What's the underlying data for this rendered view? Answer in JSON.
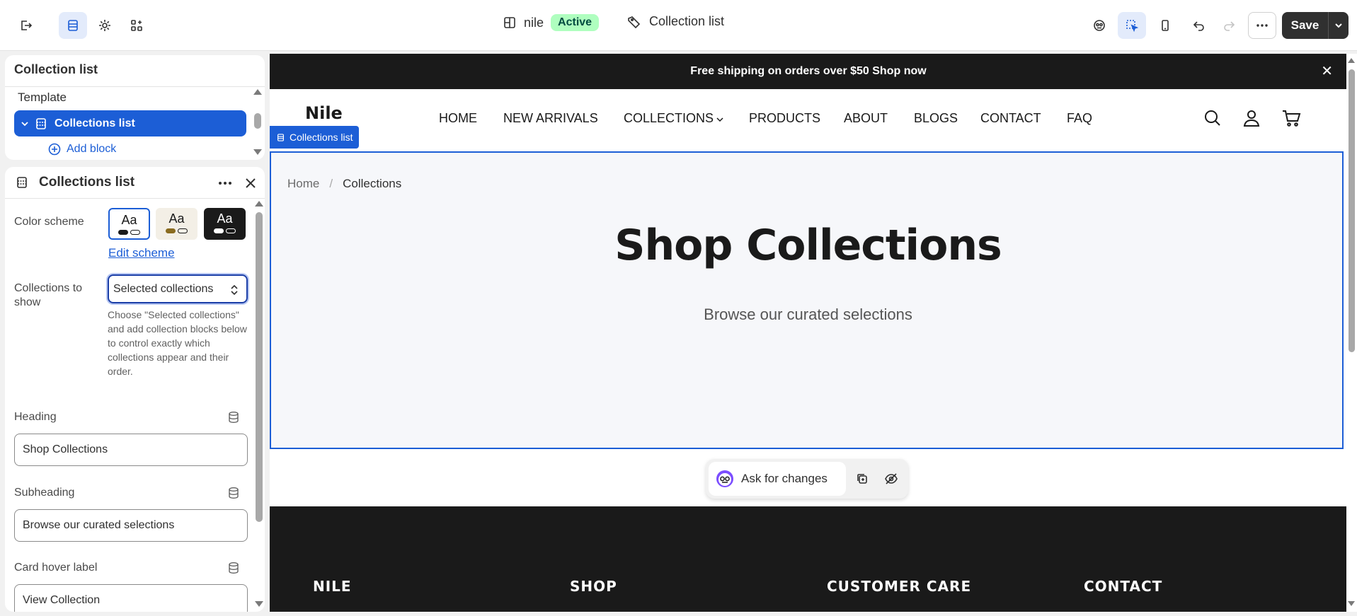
{
  "topbar": {
    "store_name": "nile",
    "status_badge": "Active",
    "page_name": "Collection list",
    "save_label": "Save"
  },
  "outline": {
    "title": "Collection list",
    "group_label": "Template",
    "selected_item": "Collections list",
    "add_block": "Add block"
  },
  "settings": {
    "title": "Collections list",
    "color_scheme_label": "Color scheme",
    "swatch_text": "Aa",
    "edit_scheme": "Edit scheme",
    "collections_label": "Collections to show",
    "collections_value": "Selected collections",
    "collections_help": "Choose \"Selected collections\" and add collection blocks below to control exactly which collections appear and their order.",
    "heading_label": "Heading",
    "heading_value": "Shop Collections",
    "subheading_label": "Subheading",
    "subheading_value": "Browse our curated selections",
    "hover_label": "Card hover label",
    "hover_value": "View Collection"
  },
  "preview": {
    "announcement": "Free shipping on orders over $50 Shop now",
    "logo": "Nile",
    "nav": [
      "HOME",
      "NEW ARRIVALS",
      "COLLECTIONS",
      "PRODUCTS",
      "ABOUT",
      "BLOGS",
      "CONTACT",
      "FAQ"
    ],
    "section_tag": "Collections list",
    "breadcrumb_home": "Home",
    "breadcrumb_sep": "/",
    "breadcrumb_current": "Collections",
    "heading": "Shop Collections",
    "subheading": "Browse our curated selections",
    "ask_label": "Ask for changes",
    "footer_cols": [
      "NILE",
      "SHOP",
      "CUSTOMER CARE",
      "CONTACT"
    ]
  },
  "colors": {
    "accent": "#1c5ed6",
    "dark": "#1a1a1a",
    "active_badge_bg": "#affebf"
  }
}
